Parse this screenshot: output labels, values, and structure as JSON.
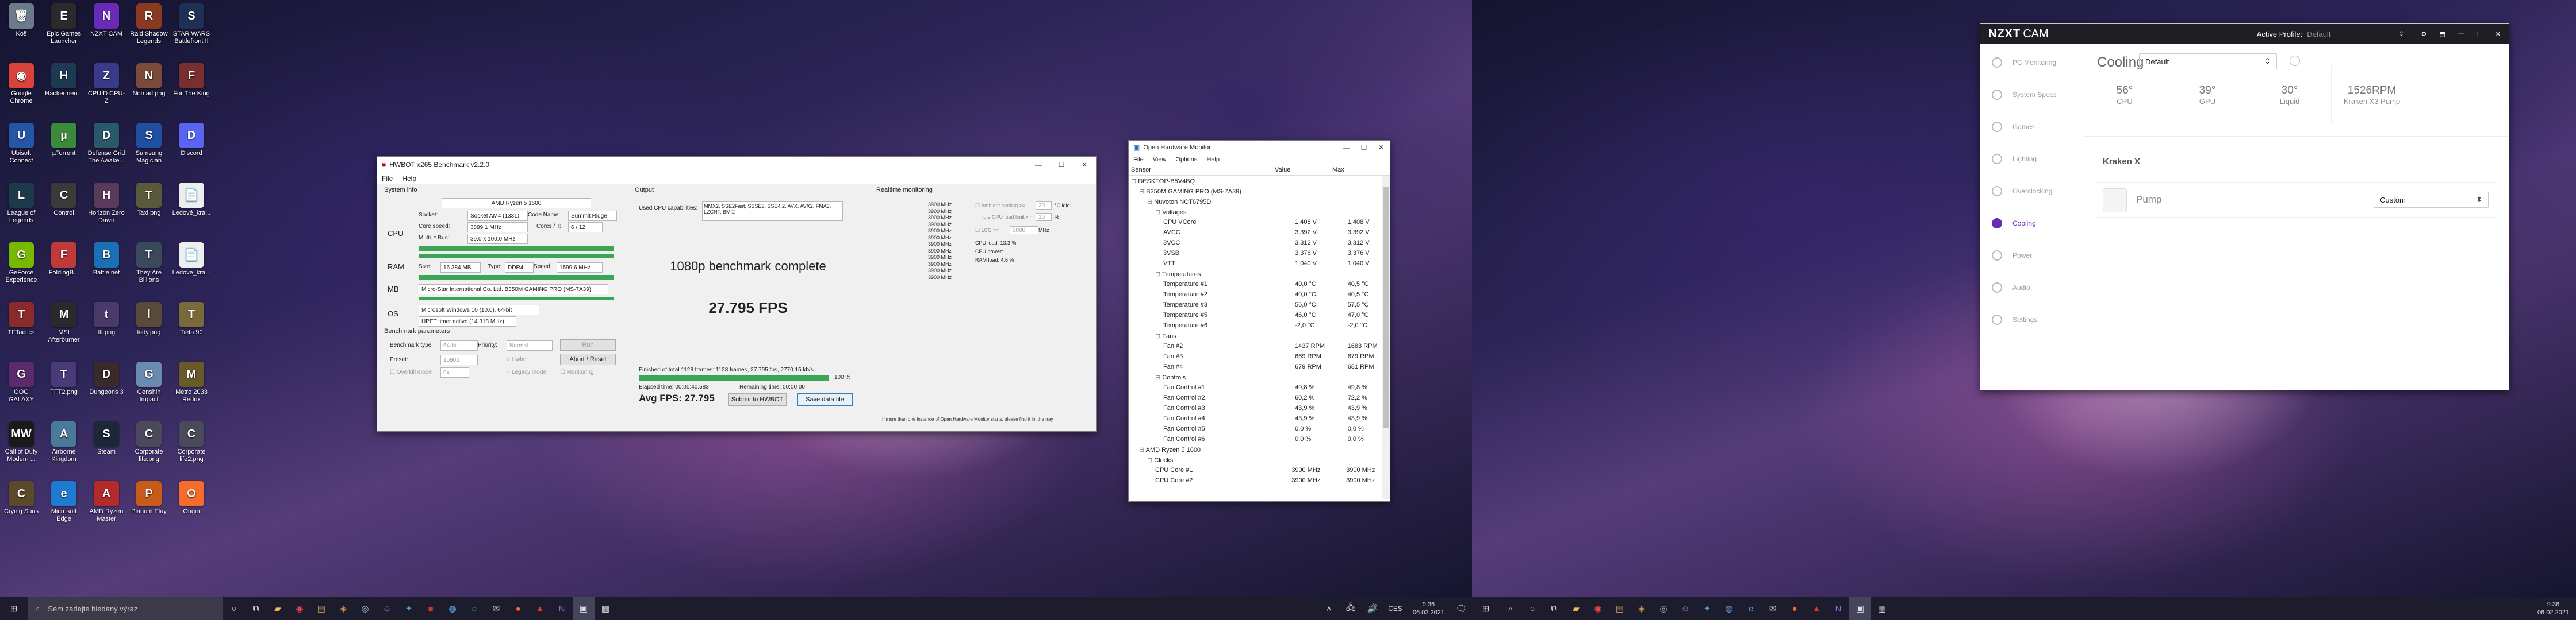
{
  "desktop_icons": [
    {
      "label": "Koš",
      "color": "#6b7b8c",
      "glyph": "🗑"
    },
    {
      "label": "Epic Games Launcher",
      "color": "#2a2a2a",
      "glyph": "E"
    },
    {
      "label": "NZXT CAM",
      "color": "#6a2ab8",
      "glyph": "N"
    },
    {
      "label": "Raid Shadow Legends",
      "color": "#8a3a20",
      "glyph": "R"
    },
    {
      "label": "STAR WARS Battlefront II",
      "color": "#1f2f55",
      "glyph": "S"
    },
    {
      "label": "Google Chrome",
      "color": "#d9433a",
      "glyph": "◉"
    },
    {
      "label": "Hackermen...",
      "color": "#1e3a52",
      "glyph": "H"
    },
    {
      "label": "CPUID CPU-Z",
      "color": "#3a3a8a",
      "glyph": "Z"
    },
    {
      "label": "Nomad.png",
      "color": "#7a4a3a",
      "glyph": "N"
    },
    {
      "label": "For The King",
      "color": "#7a2f2f",
      "glyph": "F"
    },
    {
      "label": "Ubisoft Connect",
      "color": "#2456a8",
      "glyph": "U"
    },
    {
      "label": "µTorrent",
      "color": "#3a8a3a",
      "glyph": "µ"
    },
    {
      "label": "Defense Grid The Awake...",
      "color": "#2a5a6a",
      "glyph": "D"
    },
    {
      "label": "Samsung Magician",
      "color": "#1f4fa0",
      "glyph": "S"
    },
    {
      "label": "Discord",
      "color": "#5865f2",
      "glyph": "D"
    },
    {
      "label": "League of Legends",
      "color": "#1c3a4a",
      "glyph": "L"
    },
    {
      "label": "Control",
      "color": "#3a3a3a",
      "glyph": "C"
    },
    {
      "label": "Horizon Zero Dawn",
      "color": "#5a3a5a",
      "glyph": "H"
    },
    {
      "label": "Taxi.png",
      "color": "#5a5a3a",
      "glyph": "T"
    },
    {
      "label": "Ledové_kra...",
      "color": "#eeeeee",
      "glyph": "📄"
    },
    {
      "label": "GeForce Experience",
      "color": "#76b900",
      "glyph": "G"
    },
    {
      "label": "FoldingB...",
      "color": "#c03a3a",
      "glyph": "F"
    },
    {
      "label": "Battle.net",
      "color": "#1a6fb5",
      "glyph": "B"
    },
    {
      "label": "They Are Billions",
      "color": "#3a4a5a",
      "glyph": "T"
    },
    {
      "label": "Ledové_kra...",
      "color": "#eeeeee",
      "glyph": "📄"
    },
    {
      "label": "TFTactics",
      "color": "#8a2a2a",
      "glyph": "T"
    },
    {
      "label": "MSI Afterburner",
      "color": "#2a2a2a",
      "glyph": "M"
    },
    {
      "label": "tft.png",
      "color": "#4a3a6a",
      "glyph": "t"
    },
    {
      "label": "lady.png",
      "color": "#5a4a3a",
      "glyph": "l"
    },
    {
      "label": "Tiéta 90",
      "color": "#7a6a3a",
      "glyph": "T"
    },
    {
      "label": "OOG GALAXY",
      "color": "#5a2a6a",
      "glyph": "G"
    },
    {
      "label": "TFT2.png",
      "color": "#4a3a7a",
      "glyph": "T"
    },
    {
      "label": "Dungeons 3",
      "color": "#3a2a2a",
      "glyph": "D"
    },
    {
      "label": "Genshin Impact",
      "color": "#6a8ab0",
      "glyph": "G"
    },
    {
      "label": "Metro 2033 Redux",
      "color": "#6a5a2a",
      "glyph": "M"
    },
    {
      "label": "Call of Duty Modern ...",
      "color": "#1a1a1a",
      "glyph": "MW"
    },
    {
      "label": "Airborne Kingdom",
      "color": "#4a7a9a",
      "glyph": "A"
    },
    {
      "label": "Steam",
      "color": "#1b2838",
      "glyph": "S"
    },
    {
      "label": "Corporate life.png",
      "color": "#4a4a5a",
      "glyph": "C"
    },
    {
      "label": "Corporate life2.png",
      "color": "#4a4a5a",
      "glyph": "C"
    },
    {
      "label": "Crying Suns",
      "color": "#5a4a2a",
      "glyph": "C"
    },
    {
      "label": "Microsoft Edge",
      "color": "#1f7ad1",
      "glyph": "e"
    },
    {
      "label": "AMD Ryzen Master",
      "color": "#b22a2a",
      "glyph": "A"
    },
    {
      "label": "Planum Play",
      "color": "#c85a1a",
      "glyph": "P"
    },
    {
      "label": "Origin",
      "color": "#f56c2d",
      "glyph": "O"
    }
  ],
  "hwbot": {
    "title": "HWBOT x265 Benchmark v2.2.0",
    "menu": [
      "File",
      "Help"
    ],
    "system_info_label": "System info",
    "output_label": "Output",
    "realtime_label": "Realtime monitoring",
    "cpu": {
      "label": "CPU",
      "name": "AMD Ryzen 5 1600",
      "socket_lbl": "Socket:",
      "socket": "Socket AM4 (1331)",
      "codename_lbl": "Code Name:",
      "codename": "Summit Ridge",
      "speed_lbl": "Core speed:",
      "speed": "3899.1 MHz",
      "cores_lbl": "Cores / T:",
      "cores": "6 / 12",
      "multi_lbl": "Multi. * Bus:",
      "multi": "39.0 x 100.0 MHz"
    },
    "ram": {
      "label": "RAM",
      "size_lbl": "Size:",
      "size": "16 384 MB",
      "type_lbl": "Type:",
      "type": "DDR4",
      "speed_lbl": "Speed:",
      "speed": "1599.6 MHz"
    },
    "mb": {
      "label": "MB",
      "value": "Micro-Star International Co. Ltd. B350M GAMING PRO (MS-7A39)"
    },
    "os": {
      "label": "OS",
      "value": "Microsoft Windows 10 (10.0), 64-bit",
      "timer": "HPET timer active (14.318 MHz)"
    },
    "params_label": "Benchmark parameters",
    "bench_type_lbl": "Benchmark type:",
    "bench_type": "64-bit",
    "priority_lbl": "Priority:",
    "priority": "Normal",
    "run": "Run",
    "preset_lbl": "Preset:",
    "preset": "1080p",
    "hwbot_mode": "Hwbot",
    "abort": "Abort / Reset",
    "overkill_lbl": "Overkill mode",
    "overkill": "0x",
    "legacy": "Legacy mode",
    "monitoring": "Monitoring",
    "capabilities_lbl": "Used CPU capabilities:",
    "capabilities": "MMX2, SSE2Fast, SSSE3, SSE4.2, AVX, AVX2, FMA3, LZCNT, BMI2",
    "result_title": "1080p benchmark complete",
    "result_fps": "27.795 FPS",
    "finished": "Finished of total 1128 frames: 1128 frames, 27.795 fps,  2770.15 kb/s",
    "progress": "100 %",
    "elapsed": "Elapsed time: 00:00:40.583",
    "remaining": "Remaining time: 00:00:00",
    "avg_fps": "Avg FPS: 27.795",
    "submit": "Submit to HWBOT",
    "save": "Save data file",
    "mhz_list": [
      "3900 MHz",
      "3900 MHz",
      "3900 MHz",
      "3900 MHz",
      "3900 MHz",
      "3900 MHz",
      "3900 MHz",
      "3900 MHz",
      "3900 MHz",
      "3900 MHz",
      "3900 MHz",
      "3900 MHz"
    ],
    "ambient_lbl": "Ambient cooling >=",
    "ambient_unit": "°C idle",
    "idle_lbl": "Idle CPU load limit <=",
    "idle_unit": "%",
    "lcc_lbl": "LCC >=",
    "lcc": "0000",
    "lcc_unit": "MHz",
    "cpu_load": "CPU load:  13.3 %",
    "cpu_power": "CPU power:",
    "ram_load": "RAM load:  4.6 %",
    "footer_note": "If more than one instance of Open Hardware Monitor starts, please find it in: the tray"
  },
  "ohm": {
    "title": "Open Hardware Monitor",
    "menu": [
      "File",
      "View",
      "Options",
      "Help"
    ],
    "headers": [
      "Sensor",
      "Value",
      "Max"
    ],
    "rows": [
      {
        "indent": 0,
        "name": "DESKTOP-B5V4BQ",
        "value": "",
        "max": "",
        "bold": false
      },
      {
        "indent": 1,
        "name": "B350M GAMING PRO (MS-7A39)",
        "value": "",
        "max": ""
      },
      {
        "indent": 2,
        "name": "Nuvoton NCT6795D",
        "value": "",
        "max": ""
      },
      {
        "indent": 3,
        "name": "Voltages",
        "value": "",
        "max": ""
      },
      {
        "indent": 4,
        "name": "CPU VCore",
        "value": "1,408 V",
        "max": "1,408 V"
      },
      {
        "indent": 4,
        "name": "AVCC",
        "value": "3,392 V",
        "max": "3,392 V"
      },
      {
        "indent": 4,
        "name": "3VCC",
        "value": "3,312 V",
        "max": "3,312 V"
      },
      {
        "indent": 4,
        "name": "3VSB",
        "value": "3,376 V",
        "max": "3,376 V"
      },
      {
        "indent": 4,
        "name": "VTT",
        "value": "1,040 V",
        "max": "1,040 V"
      },
      {
        "indent": 3,
        "name": "Temperatures",
        "value": "",
        "max": ""
      },
      {
        "indent": 4,
        "name": "Temperature #1",
        "value": "40,0 °C",
        "max": "40,5 °C"
      },
      {
        "indent": 4,
        "name": "Temperature #2",
        "value": "40,0 °C",
        "max": "40,5 °C"
      },
      {
        "indent": 4,
        "name": "Temperature #3",
        "value": "56,0 °C",
        "max": "57,5 °C"
      },
      {
        "indent": 4,
        "name": "Temperature #5",
        "value": "46,0 °C",
        "max": "47,0 °C"
      },
      {
        "indent": 4,
        "name": "Temperature #6",
        "value": "-2,0 °C",
        "max": "-2,0 °C"
      },
      {
        "indent": 3,
        "name": "Fans",
        "value": "",
        "max": ""
      },
      {
        "indent": 4,
        "name": "Fan #2",
        "value": "1437 RPM",
        "max": "1683 RPM"
      },
      {
        "indent": 4,
        "name": "Fan #3",
        "value": "669 RPM",
        "max": "679 RPM"
      },
      {
        "indent": 4,
        "name": "Fan #4",
        "value": "679 RPM",
        "max": "681 RPM"
      },
      {
        "indent": 3,
        "name": "Controls",
        "value": "",
        "max": ""
      },
      {
        "indent": 4,
        "name": "Fan Control #1",
        "value": "49,8 %",
        "max": "49,8 %"
      },
      {
        "indent": 4,
        "name": "Fan Control #2",
        "value": "60,2 %",
        "max": "72,2 %"
      },
      {
        "indent": 4,
        "name": "Fan Control #3",
        "value": "43,9 %",
        "max": "43,9 %"
      },
      {
        "indent": 4,
        "name": "Fan Control #4",
        "value": "43,9 %",
        "max": "43,9 %"
      },
      {
        "indent": 4,
        "name": "Fan Control #5",
        "value": "0,0 %",
        "max": "0,0 %"
      },
      {
        "indent": 4,
        "name": "Fan Control #6",
        "value": "0,0 %",
        "max": "0,0 %"
      },
      {
        "indent": 1,
        "name": "AMD Ryzen 5 1600",
        "value": "",
        "max": ""
      },
      {
        "indent": 2,
        "name": "Clocks",
        "value": "",
        "max": ""
      },
      {
        "indent": 3,
        "name": "CPU Core #1",
        "value": "3900 MHz",
        "max": "3900 MHz"
      },
      {
        "indent": 3,
        "name": "CPU Core #2",
        "value": "3900 MHz",
        "max": "3900 MHz"
      }
    ]
  },
  "nzxt": {
    "brand": "NZXT",
    "brand2": "CAM",
    "active_profile_lbl": "Active Profile:",
    "active_profile": "Default",
    "nav": [
      "PC Monitoring",
      "System Specs",
      "Games",
      "Lighting",
      "Overclocking",
      "Cooling",
      "Power",
      "Audio",
      "Settings"
    ],
    "active_nav": "Cooling",
    "page_title": "Cooling",
    "profile_select": "Default",
    "stats": [
      {
        "value": "56°",
        "label": "CPU"
      },
      {
        "value": "39°",
        "label": "GPU"
      },
      {
        "value": "30°",
        "label": "Liquid"
      },
      {
        "value": "1526RPM",
        "label": "Kraken X3 Pump"
      }
    ],
    "device": "Kraken X",
    "pump_label": "Pump",
    "pump_mode": "Custom"
  },
  "taskbar": {
    "search_placeholder": "Sem zadejte hledaný výraz",
    "clock_time": "9:36",
    "clock_date": "06.02.2021",
    "lang": "CES",
    "clock_time2": "9:36",
    "clock_date2": "06.02.2021"
  }
}
